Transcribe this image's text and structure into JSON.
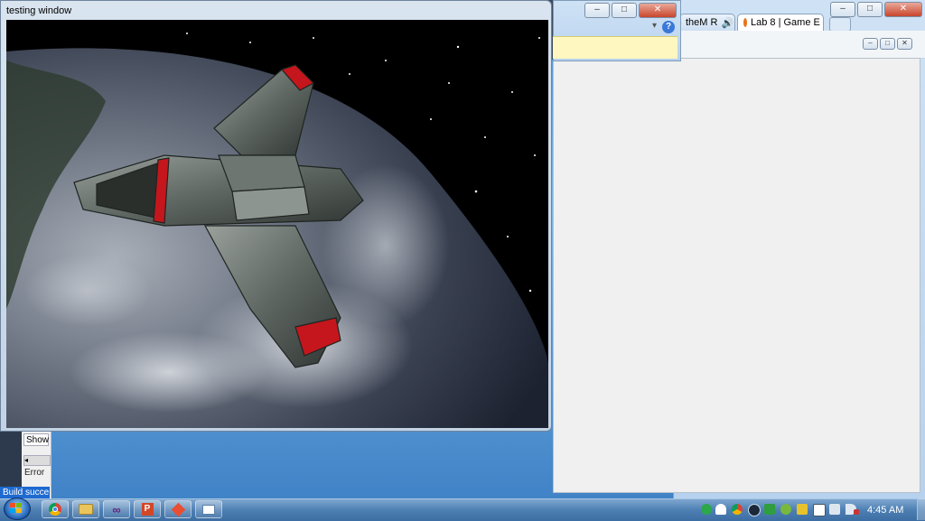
{
  "testing_window": {
    "title": "testing window"
  },
  "browser": {
    "tabs": [
      {
        "label": "theM R"
      },
      {
        "label": "Lab 8 | Game E"
      }
    ],
    "tab_close": "×"
  },
  "window_buttons": {
    "minimize": "–",
    "maximize": "□",
    "close": "✕"
  },
  "vs_panel": {
    "show_label": "Show",
    "error_label": "Error",
    "scroll_glyph": "◂"
  },
  "status_bar": {
    "text": "Build succe"
  },
  "help_glyph": "?",
  "chevron_glyph": "▾",
  "taskbar": {
    "apps": [
      "chrome-icon",
      "file-explorer-icon",
      "visual-studio-icon",
      "powerpoint-icon",
      "git-icon",
      "window-icon"
    ],
    "tray_icons": [
      "green-dot-icon",
      "notification-icon",
      "chrome-tray-icon",
      "steam-icon",
      "shield-icon",
      "utorrent-icon",
      "game-icon",
      "clipboard-icon",
      "network-icon",
      "volume-icon",
      "battery-icon"
    ],
    "clock": "4:45 AM"
  },
  "colors": {
    "accent": "#1e6ad0",
    "ship_red": "#c4161c",
    "space": "#000000"
  }
}
